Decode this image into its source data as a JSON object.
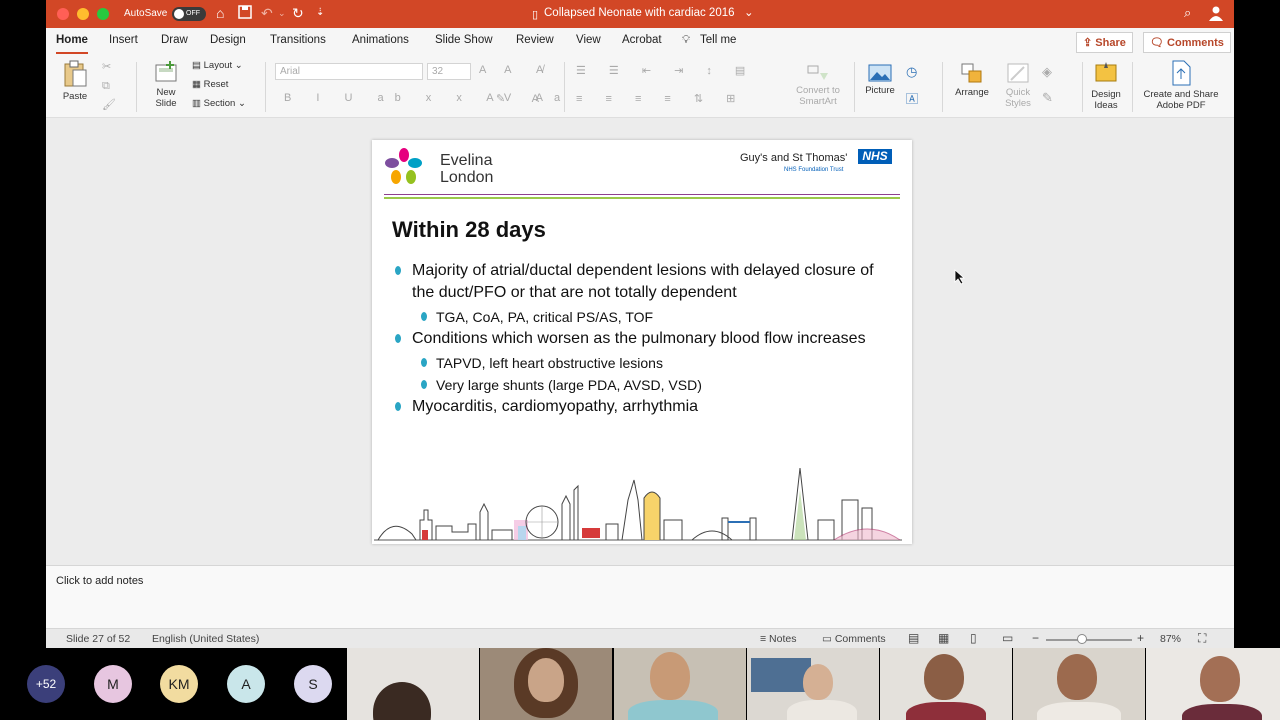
{
  "window": {
    "autosave_label": "AutoSave",
    "autosave_state": "OFF",
    "document_title": "Collapsed Neonate with cardiac 2016",
    "title_chevron": "⌄"
  },
  "ribbon_tabs": [
    {
      "label": "Home"
    },
    {
      "label": "Insert"
    },
    {
      "label": "Draw"
    },
    {
      "label": "Design"
    },
    {
      "label": "Transitions"
    },
    {
      "label": "Animations"
    },
    {
      "label": "Slide Show"
    },
    {
      "label": "Review"
    },
    {
      "label": "View"
    },
    {
      "label": "Acrobat"
    },
    {
      "label": "Tell me"
    }
  ],
  "share_label": "Share",
  "comments_label": "Comments",
  "ribbon": {
    "paste": "Paste",
    "new_slide_line1": "New",
    "new_slide_line2": "Slide",
    "layout": "Layout",
    "reset": "Reset",
    "section": "Section",
    "font_name": "Arial",
    "font_size": "32",
    "convert_line1": "Convert to",
    "convert_line2": "SmartArt",
    "picture": "Picture",
    "arrange": "Arrange",
    "quick_styles_line1": "Quick",
    "quick_styles_line2": "Styles",
    "design_ideas_line1": "Design",
    "design_ideas_line2": "Ideas",
    "create_pdf_line1": "Create and Share",
    "create_pdf_line2": "Adobe PDF"
  },
  "slide": {
    "logo_line1": "Evelina",
    "logo_line2": "London",
    "trust_name": "Guy's and St Thomas'",
    "nhs": "NHS",
    "trust_sub": "NHS Foundation Trust",
    "title": "Within 28 days",
    "bullets": [
      {
        "text": "Majority of atrial/ductal dependent lesions with delayed closure of the duct/PFO or that are not totally dependent",
        "sub": [
          "TGA, CoA, PA, critical PS/AS, TOF"
        ]
      },
      {
        "text": "Conditions which worsen as the pulmonary blood flow increases",
        "sub": [
          "TAPVD, left heart obstructive lesions",
          "Very large shunts (large PDA, AVSD, VSD)"
        ]
      },
      {
        "text": "Myocarditis, cardiomyopathy, arrhythmia",
        "sub": []
      }
    ]
  },
  "notes_placeholder": "Click to add notes",
  "status": {
    "slide_count": "Slide 27 of 52",
    "language": "English (United States)",
    "notes": "Notes",
    "comments": "Comments",
    "zoom_minus": "−",
    "zoom_plus": "+",
    "zoom": "87%"
  },
  "participants": {
    "more_count": "+52",
    "avatars": [
      {
        "initials": "M",
        "color": "#e7c6e0"
      },
      {
        "initials": "KM",
        "color": "#f2dca0"
      },
      {
        "initials": "A",
        "color": "#c9e6ea"
      },
      {
        "initials": "S",
        "color": "#dcd9f0"
      }
    ]
  },
  "colors": {
    "titlebar": "#d24726",
    "accent": "#b7472a",
    "bullet": "#2aa5c4",
    "nhs_blue": "#005eb8"
  }
}
